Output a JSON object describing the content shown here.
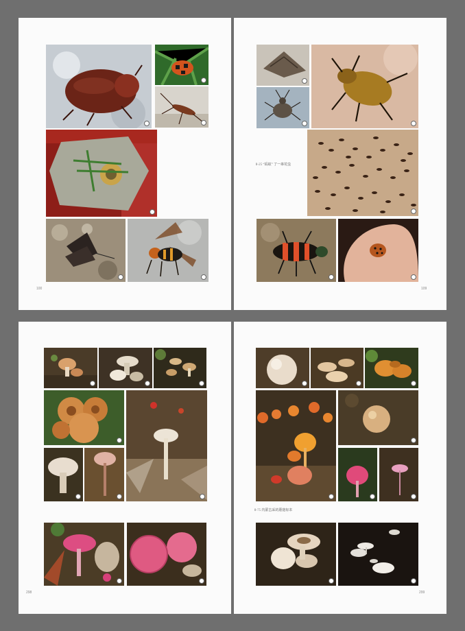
{
  "pages": {
    "top_left": {
      "page_number": "100"
    },
    "top_right": {
      "page_number": "109",
      "caption": "Ⅱ-25 “蚂蚁” 了一串花虫"
    },
    "bottom_left": {
      "page_number": "298"
    },
    "bottom_right": {
      "page_number": "299",
      "caption": "Ⅱ-75 内蒙古采的蘑菇标本"
    }
  },
  "colors": {
    "background": "#6f6f6f",
    "paper": "#fbfbfb"
  }
}
